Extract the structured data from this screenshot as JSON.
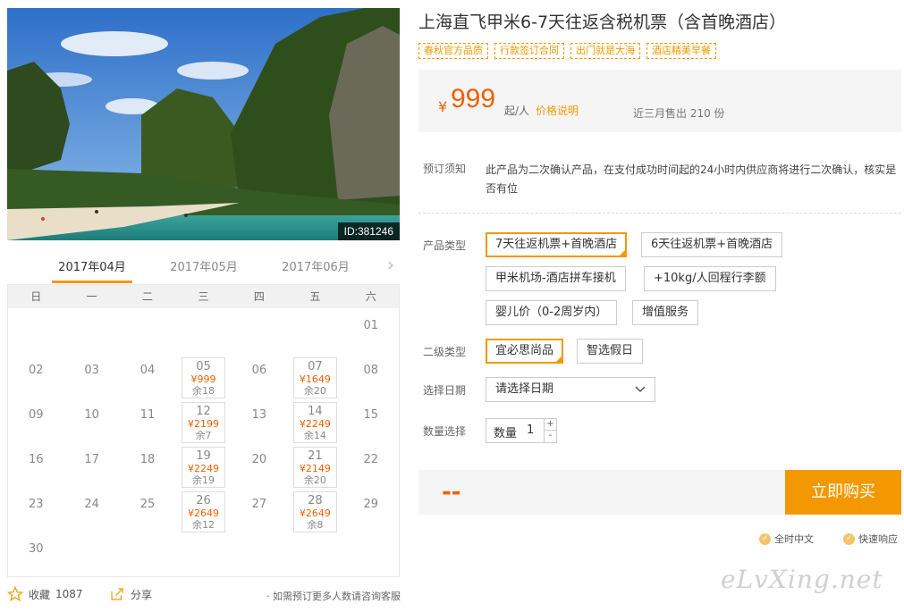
{
  "photo": {
    "id_label": "ID:381246"
  },
  "calendar": {
    "months": [
      "2017年04月",
      "2017年05月",
      "2017年06月"
    ],
    "next_icon": "›",
    "weekdays": [
      "日",
      "一",
      "二",
      "三",
      "四",
      "五",
      "六"
    ],
    "days": [
      {
        "n": ""
      },
      {
        "n": ""
      },
      {
        "n": ""
      },
      {
        "n": ""
      },
      {
        "n": ""
      },
      {
        "n": ""
      },
      {
        "n": "01"
      },
      {
        "n": "02"
      },
      {
        "n": "03"
      },
      {
        "n": "04"
      },
      {
        "n": "05",
        "price": "¥999",
        "stock": "余18"
      },
      {
        "n": "06"
      },
      {
        "n": "07",
        "price": "¥1649",
        "stock": "余20"
      },
      {
        "n": "08"
      },
      {
        "n": "09"
      },
      {
        "n": "10"
      },
      {
        "n": "11"
      },
      {
        "n": "12",
        "price": "¥2199",
        "stock": "余7"
      },
      {
        "n": "13"
      },
      {
        "n": "14",
        "price": "¥2249",
        "stock": "余14"
      },
      {
        "n": "15"
      },
      {
        "n": "16"
      },
      {
        "n": "17"
      },
      {
        "n": "18"
      },
      {
        "n": "19",
        "price": "¥2249",
        "stock": "余19"
      },
      {
        "n": "20"
      },
      {
        "n": "21",
        "price": "¥2149",
        "stock": "余20"
      },
      {
        "n": "22"
      },
      {
        "n": "23"
      },
      {
        "n": "24"
      },
      {
        "n": "25"
      },
      {
        "n": "26",
        "price": "¥2649",
        "stock": "余12"
      },
      {
        "n": "27"
      },
      {
        "n": "28",
        "price": "¥2649",
        "stock": "余8"
      },
      {
        "n": "29"
      },
      {
        "n": "30"
      }
    ]
  },
  "bottom": {
    "fav_label": "收藏",
    "fav_count": "1087",
    "share_label": "分享",
    "note": "· 如需预订更多人数请咨询客服"
  },
  "product": {
    "title": "上海直飞甲米6-7天往返含税机票（含首晚酒店）",
    "tags": [
      "春秋官方品质",
      "行款签订合同",
      "出门就是大海",
      "酒店精美早餐"
    ]
  },
  "price": {
    "yen": "¥",
    "value": "999",
    "unit": "起/人",
    "help": "价格说明",
    "sold": "近三月售出 210 份"
  },
  "notice": {
    "label": "预订须知",
    "text": "此产品为二次确认产品，在支付成功时间起的24小时内供应商将进行二次确认，核实是否有位"
  },
  "options": {
    "product_type_label": "产品类型",
    "product_types": [
      {
        "label": "7天往返机票+首晚酒店",
        "selected": true
      },
      {
        "label": "6天往返机票+首晚酒店",
        "selected": false
      },
      {
        "label": "甲米机场-酒店拼车接机",
        "selected": false
      },
      {
        "label": "+10kg/人回程行李额",
        "selected": false
      },
      {
        "label": "婴儿价（0-2周岁内）",
        "selected": false
      },
      {
        "label": "增值服务",
        "selected": false
      }
    ],
    "sub_type_label": "二级类型",
    "sub_types": [
      {
        "label": "宜必思尚品",
        "selected": true
      },
      {
        "label": "智选假日",
        "selected": false
      }
    ],
    "date_label": "选择日期",
    "date_placeholder": "请选择日期",
    "qty_label": "数量选择",
    "qty_field_label": "数量",
    "qty_value": "1",
    "qty_plus": "+",
    "qty_minus": "-"
  },
  "buy": {
    "total": "--",
    "button": "立即购买"
  },
  "guarantees": [
    "全时中文",
    "快速响应"
  ],
  "watermark": "eLvXing.net",
  "colors": {
    "accent": "#f39800",
    "price": "#f06000"
  }
}
